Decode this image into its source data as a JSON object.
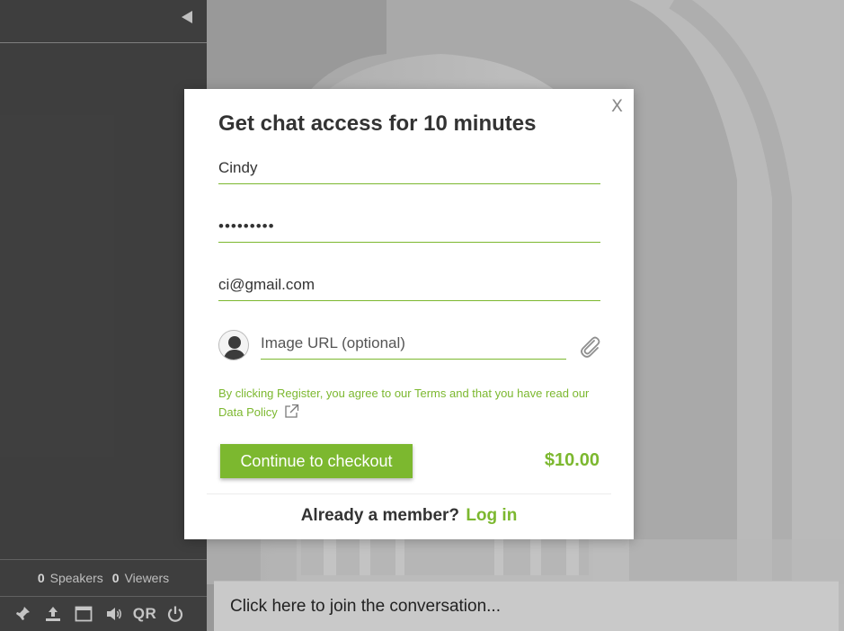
{
  "sidebar": {
    "stats": {
      "speakers_count": "0",
      "speakers_label": "Speakers",
      "viewers_count": "0",
      "viewers_label": "Viewers"
    },
    "toolbar": {
      "qr_label": "QR"
    }
  },
  "modal": {
    "title": "Get chat access for 10 minutes",
    "close_label": "X",
    "name_value": "Cindy",
    "password_value": "•••••••••",
    "email_value": "ci@gmail.com",
    "image_url_placeholder": "Image URL (optional)",
    "terms_text": "By clicking Register, you agree to our Terms and that you have read our Data Policy",
    "checkout_label": "Continue to checkout",
    "price": "$10.00",
    "member_prompt": "Already a member?",
    "login_label": "Log in"
  },
  "chat": {
    "join_placeholder": "Click here to join the conversation..."
  },
  "colors": {
    "accent": "#7cb82f",
    "sidebar_bg": "#444444",
    "modal_bg": "#ffffff"
  },
  "icons": [
    "collapse-left-icon",
    "pin-icon",
    "upload-icon",
    "window-icon",
    "volume-icon",
    "power-icon",
    "avatar-icon",
    "paperclip-icon",
    "external-link-icon"
  ]
}
